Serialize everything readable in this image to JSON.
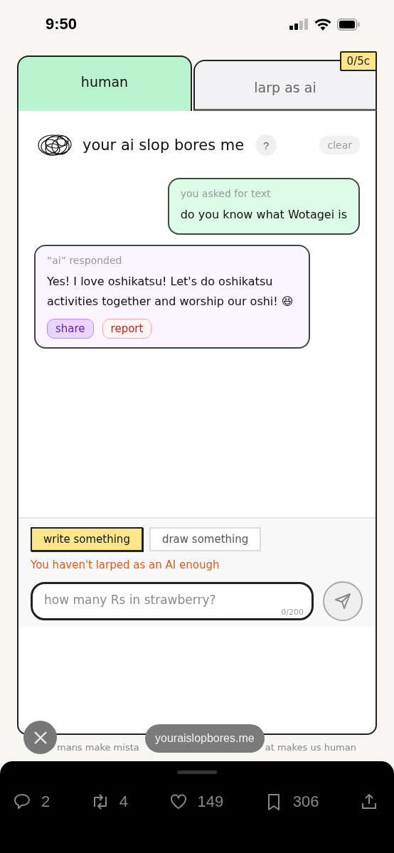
{
  "status_bar": {
    "time": "9:50"
  },
  "tabs": [
    {
      "label": "human",
      "selected": true
    },
    {
      "label": "larp as ai",
      "selected": false
    }
  ],
  "credit_badge": "0/5c",
  "header": {
    "title": "your ai slop bores me",
    "help": "?",
    "clear": "clear"
  },
  "messages": [
    {
      "kind": "user",
      "caption": "you asked for text",
      "text": "do you know what Wotagei is"
    },
    {
      "kind": "ai",
      "caption": "“ai” responded",
      "text": "Yes! I love oshikatsu! Let's do oshikatsu activities together and worship our oshi! 😆",
      "actions": [
        {
          "kind": "share",
          "label": "share"
        },
        {
          "kind": "report",
          "label": "report"
        }
      ]
    }
  ],
  "mode_buttons": [
    {
      "label": "write something",
      "selected": true
    },
    {
      "label": "draw something",
      "selected": false
    }
  ],
  "warning": "You haven't larped as an AI enough",
  "input": {
    "placeholder": "how many Rs in strawberry?",
    "counter": "0/200"
  },
  "footer_fragments": [
    "mans make mista",
    "at makes us human"
  ],
  "url_pill": "youraislopbores.me",
  "actions": [
    {
      "kind": "reply",
      "count": "2"
    },
    {
      "kind": "repost",
      "count": "4"
    },
    {
      "kind": "like",
      "count": "149"
    },
    {
      "kind": "bookmark",
      "count": "306"
    },
    {
      "kind": "share"
    }
  ]
}
